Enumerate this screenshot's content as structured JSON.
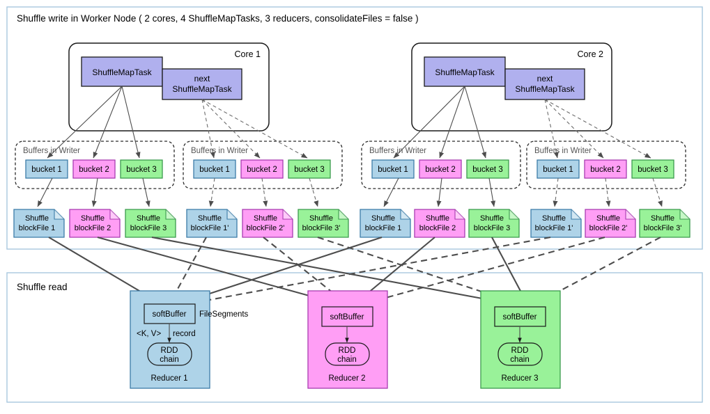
{
  "title": "Shuffle write in Worker Node ( 2 cores, 4 ShuffleMapTasks, 3 reducers, consolidateFiles = false )",
  "sections": {
    "write_title": "Shuffle write in Worker Node ( 2 cores, 4 ShuffleMapTasks, 3 reducers, consolidateFiles = false )",
    "read_title": "Shuffle read"
  },
  "cores": [
    {
      "label": "Core 1",
      "task": "ShuffleMapTask",
      "next_task_line1": "next",
      "next_task_line2": "ShuffleMapTask"
    },
    {
      "label": "Core 2",
      "task": "ShuffleMapTask",
      "next_task_line1": "next",
      "next_task_line2": "ShuffleMapTask"
    }
  ],
  "buffer_groups": [
    {
      "label": "Buffers in Writer",
      "buckets": [
        "bucket 1",
        "bucket 2",
        "bucket 3"
      ]
    },
    {
      "label": "Buffers in Writer",
      "buckets": [
        "bucket 1",
        "bucket 2",
        "bucket 3"
      ]
    },
    {
      "label": "Buffers in Writer",
      "buckets": [
        "bucket 1",
        "bucket 2",
        "bucket 3"
      ]
    },
    {
      "label": "Buffers in Writer",
      "buckets": [
        "bucket 1",
        "bucket 2",
        "bucket 3"
      ]
    }
  ],
  "block_files": [
    {
      "line1": "Shuffle",
      "line2": "blockFile 1",
      "color": "blue"
    },
    {
      "line1": "Shuffle",
      "line2": "blockFile 2",
      "color": "pink"
    },
    {
      "line1": "Shuffle",
      "line2": "blockFile 3",
      "color": "green"
    },
    {
      "line1": "Shuffle",
      "line2": "blockFile 1'",
      "color": "blue"
    },
    {
      "line1": "Shuffle",
      "line2": "blockFile 2'",
      "color": "pink"
    },
    {
      "line1": "Shuffle",
      "line2": "blockFile 3'",
      "color": "green"
    },
    {
      "line1": "Shuffle",
      "line2": "blockFile 1",
      "color": "blue"
    },
    {
      "line1": "Shuffle",
      "line2": "blockFile 2",
      "color": "pink"
    },
    {
      "line1": "Shuffle",
      "line2": "blockFile 3",
      "color": "green"
    },
    {
      "line1": "Shuffle",
      "line2": "blockFile 1'",
      "color": "blue"
    },
    {
      "line1": "Shuffle",
      "line2": "blockFile 2'",
      "color": "pink"
    },
    {
      "line1": "Shuffle",
      "line2": "blockFile 3'",
      "color": "green"
    }
  ],
  "reducers": [
    {
      "label": "Reducer 1",
      "soft_buffer": "softBuffer",
      "rdd_line1": "RDD",
      "rdd_line2": "chain",
      "record_label_left": "<K, V>",
      "record_label_right": "record",
      "file_segments_label": "FileSegments",
      "color": "blue"
    },
    {
      "label": "Reducer 2",
      "soft_buffer": "softBuffer",
      "rdd_line1": "RDD",
      "rdd_line2": "chain",
      "color": "pink"
    },
    {
      "label": "Reducer 3",
      "soft_buffer": "softBuffer",
      "rdd_line1": "RDD",
      "rdd_line2": "chain",
      "color": "green"
    }
  ],
  "colors": {
    "blue_fill": "#aed3e8",
    "blue_stroke": "#3c7ca8",
    "pink_fill": "#ff9ef5",
    "pink_stroke": "#a83cb0",
    "green_fill": "#99f299",
    "green_stroke": "#3c9a4e",
    "purple_fill": "#b0b0ee",
    "purple_stroke": "#1a1a1a",
    "panel_border": "#a8c8de",
    "line": "#4d4d4d"
  }
}
